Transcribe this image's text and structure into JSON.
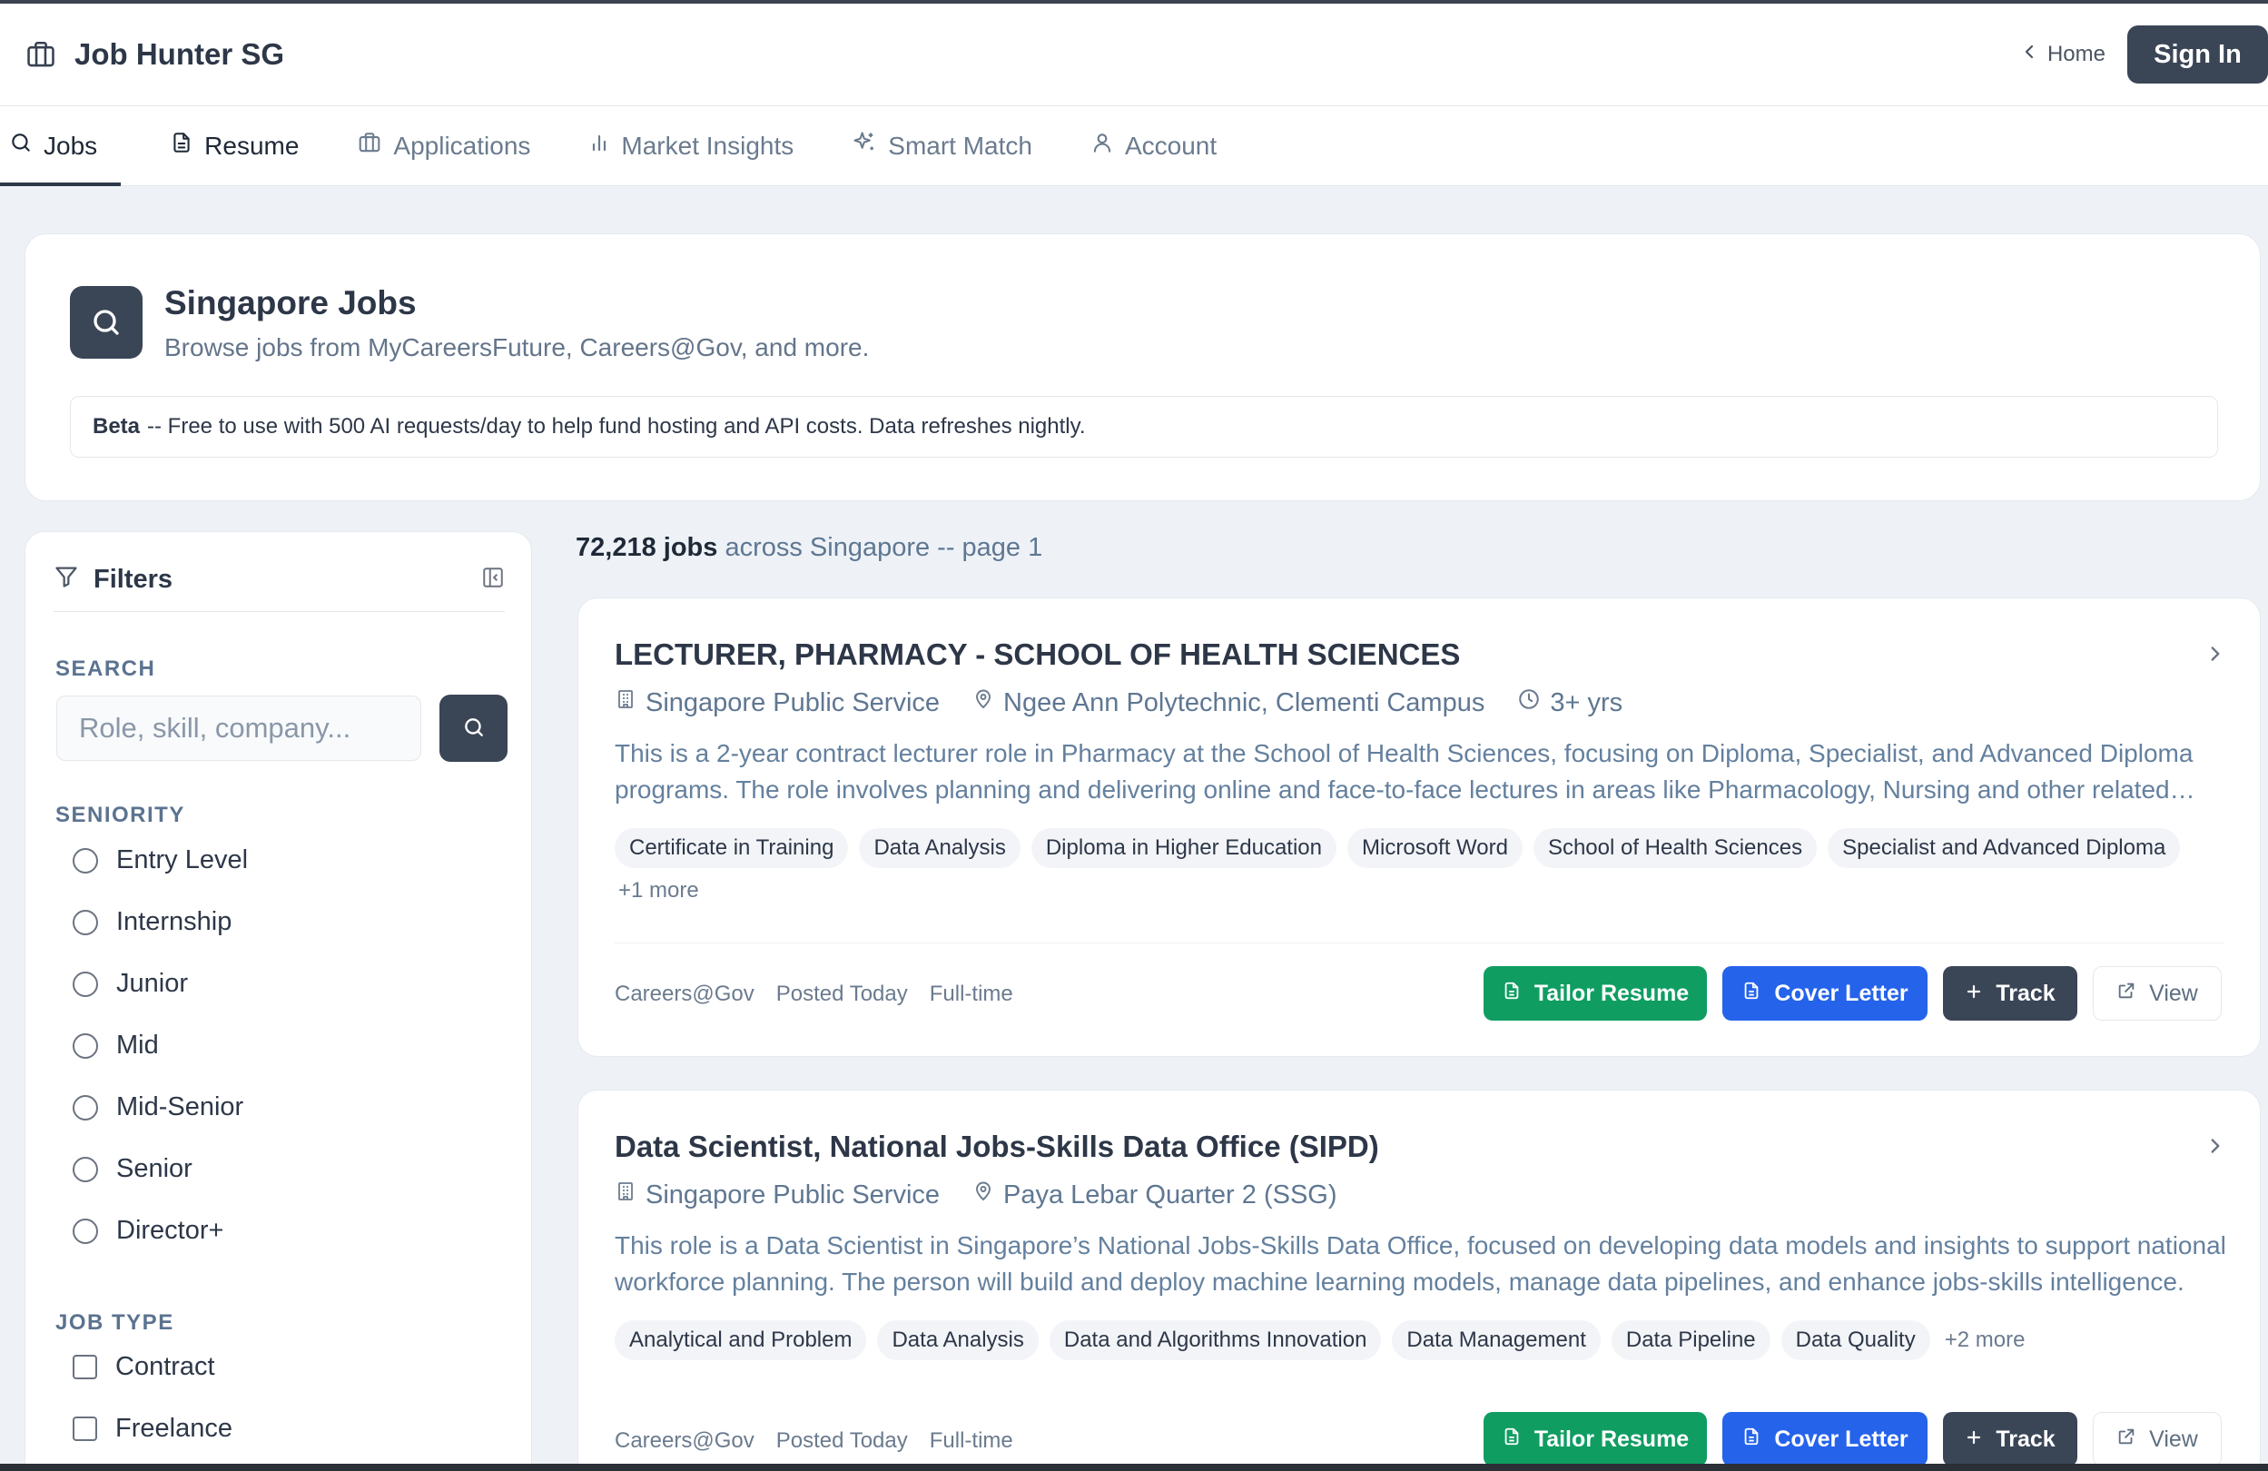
{
  "app": {
    "title": "Job Hunter SG",
    "home_label": "Home",
    "signin_label": "Sign In"
  },
  "tabs": [
    {
      "label": "Jobs",
      "active": true,
      "icon": "search-icon"
    },
    {
      "label": "Resume",
      "icon": "document-icon"
    },
    {
      "label": "Applications",
      "icon": "briefcase-icon"
    },
    {
      "label": "Market Insights",
      "icon": "bar-chart-icon"
    },
    {
      "label": "Smart Match",
      "icon": "sparkles-icon"
    },
    {
      "label": "Account",
      "icon": "user-icon"
    }
  ],
  "hero": {
    "title": "Singapore Jobs",
    "subtitle": "Browse jobs from MyCareersFuture, Careers@Gov, and more.",
    "beta_label": "Beta",
    "beta_text": "-- Free to use with 500 AI requests/day to help fund hosting and API costs. Data refreshes nightly."
  },
  "filters": {
    "title": "Filters",
    "search_label": "SEARCH",
    "search_placeholder": "Role, skill, company...",
    "seniority_label": "SENIORITY",
    "seniority_options": [
      "Entry Level",
      "Internship",
      "Junior",
      "Mid",
      "Mid-Senior",
      "Senior",
      "Director+"
    ],
    "job_type_label": "JOB TYPE",
    "job_type_options": [
      "Contract",
      "Freelance"
    ]
  },
  "results": {
    "count": "72,218 jobs",
    "suffix": "across Singapore -- page 1"
  },
  "jobs": [
    {
      "title": "LECTURER, PHARMACY - SCHOOL OF HEALTH SCIENCES",
      "company": "Singapore Public Service",
      "location": "Ngee Ann Polytechnic, Clementi Campus",
      "experience": "3+ yrs",
      "description": "This is a 2-year contract lecturer role in Pharmacy at the School of Health Sciences, focusing on Diploma, Specialist, and Advanced Diploma programs. The role involves planning and delivering online and face-to-face lectures in areas like Pharmacology, Nursing and other related topics.",
      "tags": [
        "Certificate in Training",
        "Data Analysis",
        "Diploma in Higher Education",
        "Microsoft Word",
        "School of Health Sciences",
        "Specialist and Advanced Diploma"
      ],
      "more": "+1 more",
      "source": "Careers@Gov",
      "posted": "Posted Today",
      "type": "Full-time"
    },
    {
      "title": "Data Scientist, National Jobs-Skills Data Office (SIPD)",
      "company": "Singapore Public Service",
      "location": "Paya Lebar Quarter 2 (SSG)",
      "description": "This role is a Data Scientist in Singapore’s National Jobs-Skills Data Office, focused on developing data models and insights to support national workforce planning. The person will build and deploy machine learning models, manage data pipelines, and enhance jobs-skills intelligence.",
      "tags": [
        "Analytical and Problem",
        "Data Analysis",
        "Data and Algorithms Innovation",
        "Data Management",
        "Data Pipeline",
        "Data Quality"
      ],
      "more": "+2 more",
      "source": "Careers@Gov",
      "posted": "Posted Today",
      "type": "Full-time"
    }
  ],
  "actions": {
    "tailor": "Tailor Resume",
    "cover": "Cover Letter",
    "track": "Track",
    "view": "View"
  }
}
